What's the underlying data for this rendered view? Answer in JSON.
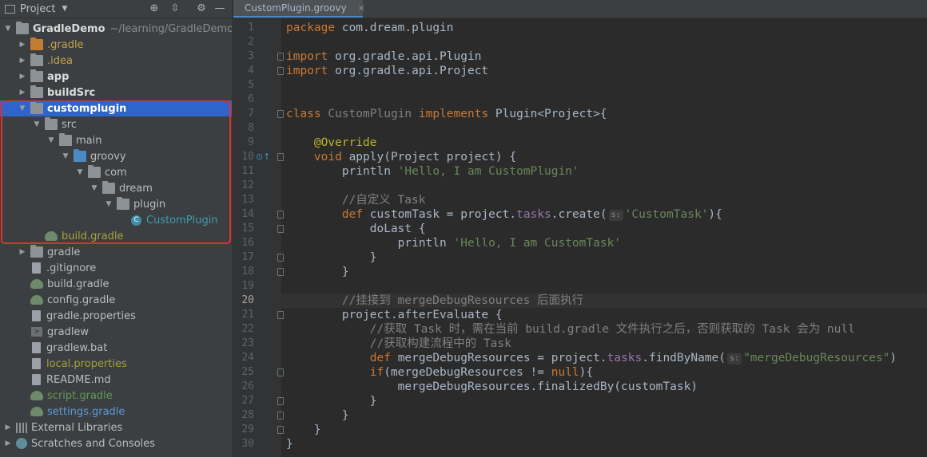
{
  "project_panel": {
    "title": "Project",
    "icons": [
      "target-icon",
      "collapse-icon",
      "gear-icon",
      "minimize-icon"
    ]
  },
  "tree": [
    {
      "depth": 0,
      "arrow": "down",
      "icon": "folder",
      "label": "GradleDemo",
      "path": "~/learning/GradleDemo",
      "style": "bold"
    },
    {
      "depth": 1,
      "arrow": "right",
      "icon": "folder-orange",
      "label": ".gradle",
      "style": "orange"
    },
    {
      "depth": 1,
      "arrow": "right",
      "icon": "folder",
      "label": ".idea",
      "style": "orange"
    },
    {
      "depth": 1,
      "arrow": "right",
      "icon": "folder",
      "label": "app",
      "style": "bold"
    },
    {
      "depth": 1,
      "arrow": "right",
      "icon": "folder",
      "label": "buildSrc",
      "style": "bold"
    },
    {
      "depth": 1,
      "arrow": "down",
      "icon": "folder",
      "label": "customplugin",
      "style": "white",
      "selected": true
    },
    {
      "depth": 2,
      "arrow": "down",
      "icon": "folder",
      "label": "src",
      "style": ""
    },
    {
      "depth": 3,
      "arrow": "down",
      "icon": "folder",
      "label": "main",
      "style": ""
    },
    {
      "depth": 4,
      "arrow": "down",
      "icon": "folder-blue",
      "label": "groovy",
      "style": ""
    },
    {
      "depth": 5,
      "arrow": "down",
      "icon": "folder",
      "label": "com",
      "style": ""
    },
    {
      "depth": 6,
      "arrow": "down",
      "icon": "folder",
      "label": "dream",
      "style": ""
    },
    {
      "depth": 7,
      "arrow": "down",
      "icon": "folder",
      "label": "plugin",
      "style": ""
    },
    {
      "depth": 8,
      "arrow": "",
      "icon": "class",
      "label": "CustomPlugin",
      "style": "teal"
    },
    {
      "depth": 2,
      "arrow": "",
      "icon": "gradle",
      "label": "build.gradle",
      "style": "olive"
    },
    {
      "depth": 1,
      "arrow": "right",
      "icon": "folder",
      "label": "gradle",
      "style": ""
    },
    {
      "depth": 1,
      "arrow": "",
      "icon": "file",
      "label": ".gitignore",
      "style": ""
    },
    {
      "depth": 1,
      "arrow": "",
      "icon": "gradle",
      "label": "build.gradle",
      "style": ""
    },
    {
      "depth": 1,
      "arrow": "",
      "icon": "gradle",
      "label": "config.gradle",
      "style": ""
    },
    {
      "depth": 1,
      "arrow": "",
      "icon": "file",
      "label": "gradle.properties",
      "style": ""
    },
    {
      "depth": 1,
      "arrow": "",
      "icon": "terminal",
      "label": "gradlew",
      "style": ""
    },
    {
      "depth": 1,
      "arrow": "",
      "icon": "file",
      "label": "gradlew.bat",
      "style": ""
    },
    {
      "depth": 1,
      "arrow": "",
      "icon": "file",
      "label": "local.properties",
      "style": "olive"
    },
    {
      "depth": 1,
      "arrow": "",
      "icon": "file",
      "label": "README.md",
      "style": ""
    },
    {
      "depth": 1,
      "arrow": "",
      "icon": "gradle",
      "label": "script.gradle",
      "style": "green"
    },
    {
      "depth": 1,
      "arrow": "",
      "icon": "gradle",
      "label": "settings.gradle",
      "style": "blue"
    },
    {
      "depth": 0,
      "arrow": "right",
      "icon": "library",
      "label": "External Libraries",
      "style": ""
    },
    {
      "depth": 0,
      "arrow": "right",
      "icon": "scratch",
      "label": "Scratches and Consoles",
      "style": ""
    }
  ],
  "editor": {
    "tab_label": "CustomPlugin.groovy",
    "current_line": 20,
    "lines": [
      [
        [
          "kw",
          "package"
        ],
        [
          "",
          "com.dream.plugin"
        ]
      ],
      [],
      [
        [
          "kw",
          "import"
        ],
        [
          "",
          "org.gradle.api.Plugin"
        ]
      ],
      [
        [
          "kw",
          "import"
        ],
        [
          "",
          "org.gradle.api.Project"
        ]
      ],
      [],
      [],
      [
        [
          "kw",
          "class "
        ],
        [
          "cname",
          "CustomPlugin "
        ],
        [
          "kw",
          "implements "
        ],
        [
          "",
          "Plugin<Project>{"
        ]
      ],
      [],
      [
        [
          "an",
          "    @Override"
        ]
      ],
      [
        [
          "kw",
          "    void "
        ],
        [
          "",
          "apply(Project project) {"
        ]
      ],
      [
        [
          "",
          "        println "
        ],
        [
          "str",
          "'Hello, I am CustomPlugin'"
        ]
      ],
      [],
      [
        [
          "cm",
          "        //自定义 Task"
        ]
      ],
      [
        [
          "kw",
          "        def "
        ],
        [
          "",
          "customTask = project."
        ],
        [
          "fld",
          "tasks"
        ],
        [
          "",
          ".create("
        ],
        [
          "hint",
          "s:"
        ],
        [
          "str",
          "'CustomTask'"
        ],
        [
          "",
          "){"
        ]
      ],
      [
        [
          "",
          "            doLast {"
        ]
      ],
      [
        [
          "",
          "                println "
        ],
        [
          "str",
          "'Hello, I am CustomTask'"
        ]
      ],
      [
        [
          "",
          "            }"
        ]
      ],
      [
        [
          "",
          "        }"
        ]
      ],
      [],
      [
        [
          "cm",
          "        //挂接到 mergeDebugResources 后面执行"
        ]
      ],
      [
        [
          "",
          "        project.afterEvaluate {"
        ]
      ],
      [
        [
          "cm",
          "            //获取 Task 时，需在当前 build.gradle 文件执行之后，否则获取的 Task 会为 null"
        ]
      ],
      [
        [
          "cm",
          "            //获取构建流程中的 Task"
        ]
      ],
      [
        [
          "kw",
          "            def "
        ],
        [
          "",
          "mergeDebugResources = project."
        ],
        [
          "fld",
          "tasks"
        ],
        [
          "",
          ".findByName("
        ],
        [
          "hint",
          "s:"
        ],
        [
          "str",
          "\"mergeDebugResources\""
        ],
        [
          "",
          ")"
        ]
      ],
      [
        [
          "kw",
          "            if"
        ],
        [
          "",
          "(mergeDebugResources != "
        ],
        [
          "kw",
          "null"
        ],
        [
          "",
          "){"
        ]
      ],
      [
        [
          "",
          "                mergeDebugResources.finalizedBy(customTask)"
        ]
      ],
      [
        [
          "",
          "            }"
        ]
      ],
      [
        [
          "",
          "        }"
        ]
      ],
      [
        [
          "",
          "    }"
        ]
      ],
      [
        [
          "",
          "}"
        ]
      ]
    ]
  }
}
